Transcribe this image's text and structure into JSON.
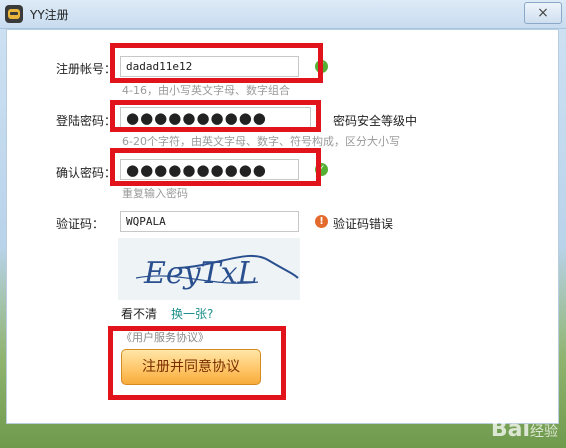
{
  "window": {
    "title": "YY注册",
    "close_label": "×"
  },
  "username": {
    "label": "注册帐号：",
    "value": "dadad11e12",
    "hint": "4-16，由小写英文字母、数字组合"
  },
  "password": {
    "label": "登陆密码：",
    "value": "●●●●●●●●●●",
    "strength": "密码安全等级中",
    "hint": "6-20个字符，由英文字母、数字、符号构成，区分大小写"
  },
  "confirm": {
    "label": "确认密码：",
    "value": "●●●●●●●●●●",
    "hint": "重复输入密码"
  },
  "captcha": {
    "label": "验证码：",
    "value": "WQPALA",
    "error": "验证码错误",
    "image_text": "EeyTxL",
    "cant_see": "看不清",
    "refresh": "换一张?"
  },
  "agreement": {
    "link": "《用户服务协议》",
    "button": "注册并同意协议"
  },
  "watermark": {
    "text": "Bai",
    "sub": "经验"
  },
  "colors": {
    "accent_red": "#e0141a",
    "ok_green": "#53b033",
    "warn_orange": "#e36a2c",
    "link_teal": "#1d8f8c"
  }
}
